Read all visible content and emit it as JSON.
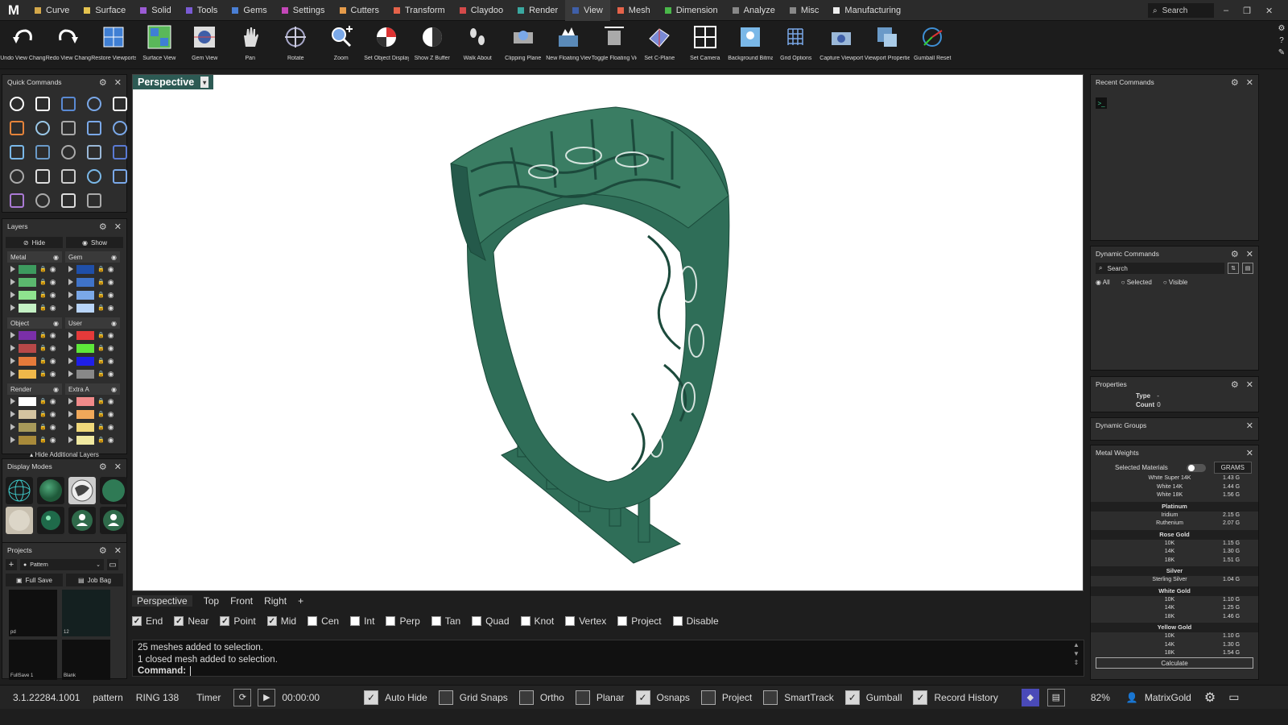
{
  "app": {
    "logo": "M"
  },
  "menus": [
    {
      "label": "Curve",
      "color": "#d4a84a"
    },
    {
      "label": "Surface",
      "color": "#e5c34f"
    },
    {
      "label": "Solid",
      "color": "#9b5bd4"
    },
    {
      "label": "Tools",
      "color": "#7a5bd4"
    },
    {
      "label": "Gems",
      "color": "#4a7fd4"
    },
    {
      "label": "Settings",
      "color": "#c447b8"
    },
    {
      "label": "Cutters",
      "color": "#e59b4a"
    },
    {
      "label": "Transform",
      "color": "#e5634a"
    },
    {
      "label": "Claydoo",
      "color": "#d44a4a"
    },
    {
      "label": "Render",
      "color": "#3aa8a0"
    },
    {
      "label": "View",
      "color": "#3f5fa8",
      "active": true
    },
    {
      "label": "Mesh",
      "color": "#e5634a"
    },
    {
      "label": "Dimension",
      "color": "#4ab84a"
    },
    {
      "label": "Analyze",
      "color": "#888888"
    },
    {
      "label": "Misc",
      "color": "#888888"
    },
    {
      "label": "Manufacturing",
      "color": "#eeeeee"
    }
  ],
  "top_search": {
    "placeholder": "Search"
  },
  "window_controls": [
    "–",
    "❐",
    "✕"
  ],
  "toolbar": [
    {
      "label": "Undo View Change",
      "icon": "undo-view-icon"
    },
    {
      "label": "Redo View Change",
      "icon": "redo-view-icon"
    },
    {
      "label": "Restore Viewports",
      "icon": "restore-viewports-icon"
    },
    {
      "label": "Surface View",
      "icon": "surface-view-icon"
    },
    {
      "label": "Gem View",
      "icon": "gem-view-icon"
    },
    {
      "label": "Pan",
      "icon": "hand-icon"
    },
    {
      "label": "Rotate",
      "icon": "rotate-icon"
    },
    {
      "label": "Zoom",
      "icon": "zoom-icon"
    },
    {
      "label": "Set Object Display M...",
      "icon": "display-mode-icon"
    },
    {
      "label": "Show Z Buffer",
      "icon": "z-buffer-icon"
    },
    {
      "label": "Walk About",
      "icon": "footprints-icon"
    },
    {
      "label": "Clipping Plane",
      "icon": "clipping-plane-icon"
    },
    {
      "label": "New Floating Viewport",
      "icon": "floating-viewport-icon"
    },
    {
      "label": "Toggle Floating View...",
      "icon": "toggle-floating-icon"
    },
    {
      "label": "Set C-Plane",
      "icon": "cplane-icon"
    },
    {
      "label": "Set Camera",
      "icon": "camera-layout-icon"
    },
    {
      "label": "Background Bitmap",
      "icon": "background-bitmap-icon"
    },
    {
      "label": "Grid Options",
      "icon": "grid-icon"
    },
    {
      "label": "Capture Viewport",
      "icon": "capture-icon"
    },
    {
      "label": "Viewport Properties",
      "icon": "viewport-properties-icon"
    },
    {
      "label": "Gumball Reset",
      "icon": "gumball-icon"
    }
  ],
  "right_strip": [
    "⚙",
    "?",
    "✎"
  ],
  "quick_commands": {
    "title": "Quick Commands"
  },
  "layers": {
    "title": "Layers",
    "hide_label": "Hide",
    "show_label": "Show",
    "groups": [
      {
        "name": "Metal",
        "colors": [
          "#3d9a5e",
          "#5bb86e",
          "#8fe38f",
          "#c4f0c4"
        ]
      },
      {
        "name": "Gem",
        "colors": [
          "#1f4fa8",
          "#3f73c8",
          "#7aa8e8",
          "#b8d4f8"
        ]
      },
      {
        "name": "Object",
        "colors": [
          "#7a2fa8",
          "#b84848",
          "#e57a3a",
          "#f0b84a"
        ]
      },
      {
        "name": "User",
        "colors": [
          "#e53a3a",
          "#5ee83a",
          "#1f1fe8",
          "#888888"
        ]
      },
      {
        "name": "Render",
        "colors": [
          "#ffffff",
          "#d4c4a0",
          "#a89a5a",
          "#a88a3a"
        ]
      },
      {
        "name": "Extra A",
        "colors": [
          "#f08a8a",
          "#f0a85a",
          "#f0d87a",
          "#f0e8a0"
        ]
      }
    ],
    "footer": "Hide Additional Layers"
  },
  "display_modes": {
    "title": "Display Modes"
  },
  "projects": {
    "title": "Projects",
    "current": "Pattern",
    "full_save": "Full Save",
    "job_bag": "Job Bag",
    "cards": [
      {
        "label": "pd"
      },
      {
        "label": "12"
      },
      {
        "label": "FullSave 1"
      },
      {
        "label": "Blank"
      }
    ]
  },
  "viewport": {
    "label": "Perspective"
  },
  "view_tabs": [
    "Perspective",
    "Top",
    "Front",
    "Right",
    "+"
  ],
  "snaps": [
    {
      "label": "End",
      "on": true
    },
    {
      "label": "Near",
      "on": true
    },
    {
      "label": "Point",
      "on": true
    },
    {
      "label": "Mid",
      "on": true
    },
    {
      "label": "Cen",
      "on": false
    },
    {
      "label": "Int",
      "on": false
    },
    {
      "label": "Perp",
      "on": false
    },
    {
      "label": "Tan",
      "on": false
    },
    {
      "label": "Quad",
      "on": false
    },
    {
      "label": "Knot",
      "on": false
    },
    {
      "label": "Vertex",
      "on": false
    },
    {
      "label": "Project",
      "on": false
    },
    {
      "label": "Disable",
      "on": false
    }
  ],
  "command": {
    "history": [
      "25 meshes added to selection.",
      "1 closed mesh added to selection."
    ],
    "prompt": "Command:"
  },
  "recent_commands": {
    "title": "Recent Commands"
  },
  "dynamic_commands": {
    "title": "Dynamic Commands",
    "search_placeholder": "Search",
    "filters": [
      "All",
      "Selected",
      "Visible"
    ]
  },
  "properties": {
    "title": "Properties",
    "rows": [
      {
        "key": "Type",
        "value": "-"
      },
      {
        "key": "Count",
        "value": "0"
      }
    ]
  },
  "dynamic_groups": {
    "title": "Dynamic Groups"
  },
  "metal_weights": {
    "title": "Metal Weights",
    "selected_materials": "Selected Materials",
    "units": "GRAMS",
    "rows": [
      {
        "type": "row",
        "name": "White Super 14K",
        "value": "1.43 G"
      },
      {
        "type": "row",
        "name": "White 14K",
        "value": "1.44 G"
      },
      {
        "type": "row",
        "name": "White 18K",
        "value": "1.56 G"
      },
      {
        "type": "head",
        "name": "Platinum"
      },
      {
        "type": "row",
        "name": "Iridium",
        "value": "2.15 G"
      },
      {
        "type": "row",
        "name": "Ruthenium",
        "value": "2.07 G"
      },
      {
        "type": "head",
        "name": "Rose Gold"
      },
      {
        "type": "row",
        "name": "10K",
        "value": "1.15 G"
      },
      {
        "type": "row",
        "name": "14K",
        "value": "1.30 G"
      },
      {
        "type": "row",
        "name": "18K",
        "value": "1.51 G"
      },
      {
        "type": "head",
        "name": "Silver"
      },
      {
        "type": "row",
        "name": "Sterling Silver",
        "value": "1.04 G"
      },
      {
        "type": "head",
        "name": "White Gold"
      },
      {
        "type": "row",
        "name": "10K",
        "value": "1.10 G"
      },
      {
        "type": "row",
        "name": "14K",
        "value": "1.25 G"
      },
      {
        "type": "row",
        "name": "18K",
        "value": "1.46 G"
      },
      {
        "type": "head",
        "name": "Yellow Gold"
      },
      {
        "type": "row",
        "name": "10K",
        "value": "1.10 G"
      },
      {
        "type": "row",
        "name": "14K",
        "value": "1.30 G"
      },
      {
        "type": "row",
        "name": "18K",
        "value": "1.54 G"
      }
    ],
    "calculate": "Calculate"
  },
  "status": {
    "version": "3.1.22284.1001",
    "project": "pattern",
    "file": "RING 138",
    "timer_label": "Timer",
    "timer_value": "00:00:00",
    "toggles": [
      {
        "label": "Auto Hide",
        "on": true
      },
      {
        "label": "Grid Snaps",
        "on": false
      },
      {
        "label": "Ortho",
        "on": false
      },
      {
        "label": "Planar",
        "on": false
      },
      {
        "label": "Osnaps",
        "on": true
      },
      {
        "label": "Project",
        "on": false
      },
      {
        "label": "SmartTrack",
        "on": false
      },
      {
        "label": "Gumball",
        "on": true
      },
      {
        "label": "Record History",
        "on": true
      }
    ],
    "zoom": "82%",
    "user": "MatrixGold"
  }
}
